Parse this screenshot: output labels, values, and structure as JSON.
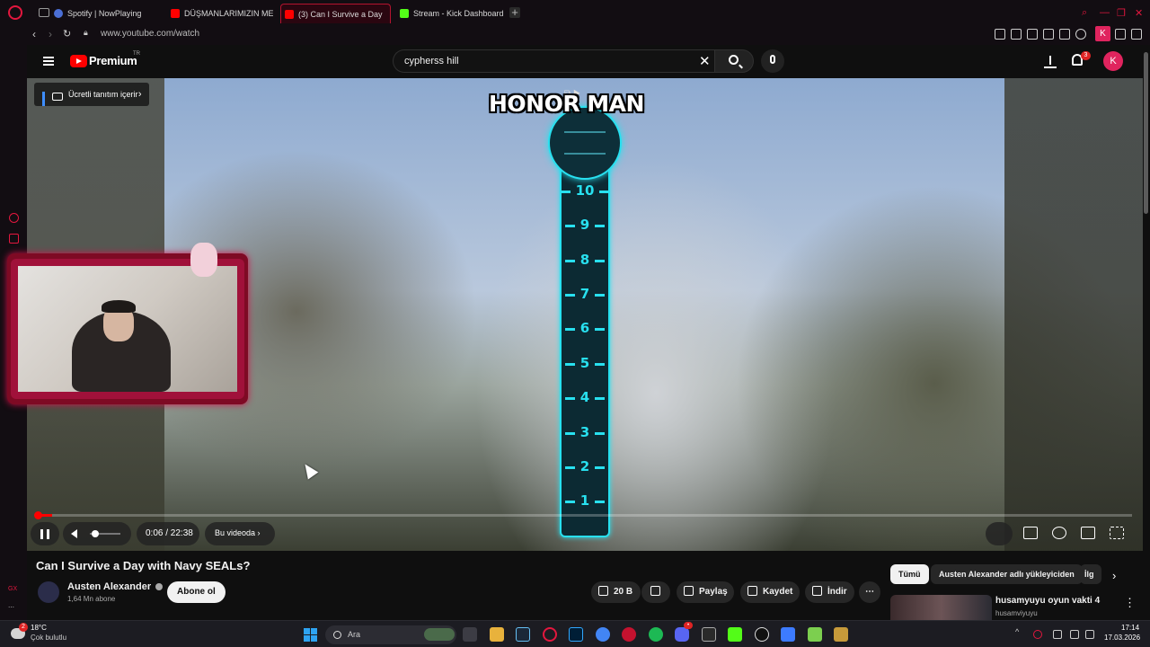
{
  "browser": {
    "tabs": [
      {
        "label": "Spotify | NowPlaying",
        "favicon": "globe-icon"
      },
      {
        "label": "DÜŞMANLARIMIZIN MEKA",
        "favicon": "youtube-icon"
      },
      {
        "label": "(3) Can I Survive a Day",
        "favicon": "youtube-icon",
        "active": true
      },
      {
        "label": "Stream - Kick Dashboard",
        "favicon": "kick-icon"
      }
    ],
    "url": "www.youtube.com/watch",
    "profile_initial": "K"
  },
  "sidebar": {
    "bottom_label": "GX"
  },
  "youtube": {
    "logo_text": "Premium",
    "region": "TR",
    "search_value": "cypherss hill",
    "notification_count": "3",
    "avatar_initial": "K"
  },
  "player": {
    "promo_label": "Ücretli tanıtım içerir",
    "overlay_title": "HONOR MAN",
    "meter_ticks": [
      "10",
      "9",
      "8",
      "7",
      "6",
      "5",
      "4",
      "3",
      "2",
      "1"
    ],
    "time": "0:06 / 22:38",
    "chapter": "Bu videoda",
    "progress_percent": 0.45,
    "volume_percent": 5
  },
  "video": {
    "title": "Can I Survive a Day with Navy SEALs?",
    "channel": "Austen Alexander",
    "subscribers": "1,64 Mn abone",
    "subscribe_label": "Abone ol",
    "likes": "20 B",
    "share_label": "Paylaş",
    "save_label": "Kaydet",
    "download_label": "İndir"
  },
  "chips": [
    {
      "label": "Tümü",
      "selected": true
    },
    {
      "label": "Austen Alexander adlı yükleyiciden",
      "selected": false
    },
    {
      "label": "İlg",
      "selected": false
    }
  ],
  "recommendation": {
    "title": "husamyuyu oyun vakti 4",
    "channel": "husamviyuyu"
  },
  "taskbar": {
    "weather_badge": "2",
    "temperature": "18°C",
    "weather": "Çok bulutlu",
    "search_placeholder": "Ara",
    "time": "17:14",
    "date": "17.03.2026"
  },
  "colors": {
    "accent_browser": "#e3173e",
    "youtube_red": "#ff0000",
    "meter_cyan": "#28e0ef"
  }
}
